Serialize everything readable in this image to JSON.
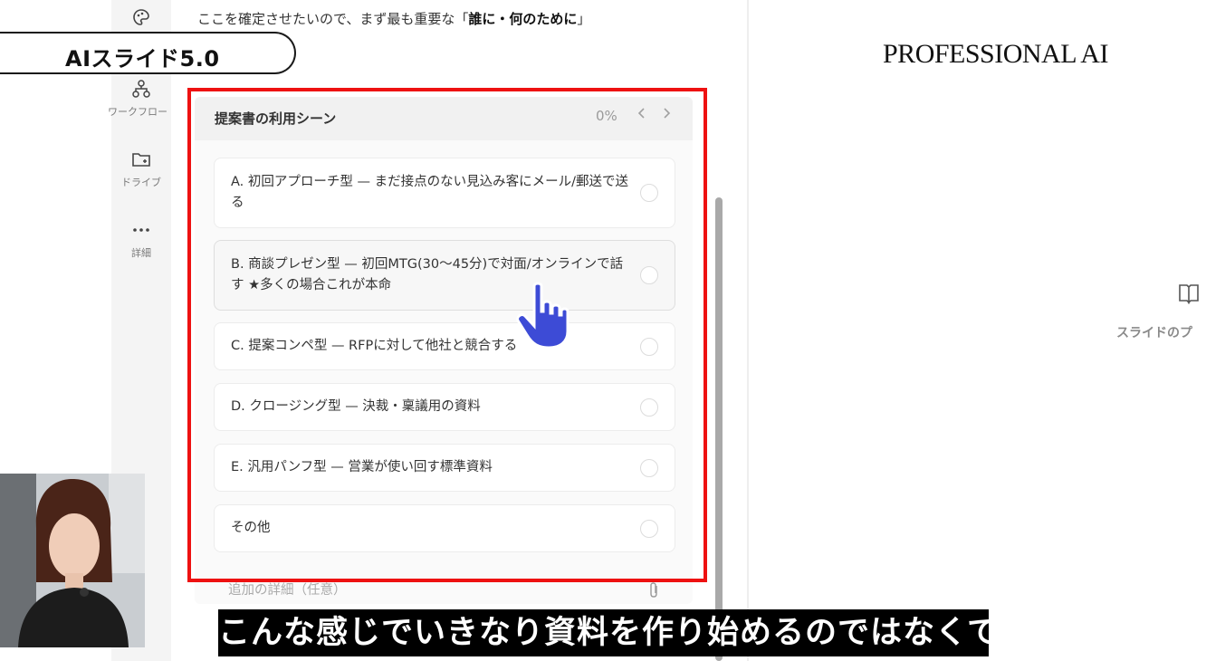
{
  "overlay": {
    "badge": "AIスライド5.0",
    "brand": "PROFESSIONAL AI",
    "caption": "こんな感じでいきなり資料を作り始めるのではなくて"
  },
  "sidebar": {
    "items": [
      {
        "label": "ワークフロー",
        "icon": "workflow-icon"
      },
      {
        "label": "ドライブ",
        "icon": "drive-folder-icon"
      },
      {
        "label": "詳細",
        "icon": "more-icon"
      }
    ]
  },
  "chat": {
    "intro_prefix": "ここを確定させたいので、まず最も重要な「",
    "intro_bold": "誰に・何のために",
    "intro_suffix": "」"
  },
  "question": {
    "title": "提案書の利用シーン",
    "progress": "0%",
    "options": [
      "A. 初回アプローチ型 — まだ接点のない見込み客にメール/郵送で送る",
      "B. 商談プレゼン型 — 初回MTG(30〜45分)で対面/オンラインで話す ★多くの場合これが本命",
      "C. 提案コンペ型 — RFPに対して他社と競合する",
      "D. クロージング型 — 決裁・稟議用の資料",
      "E. 汎用パンフ型 — 営業が使い回す標準資料",
      "その他"
    ],
    "details_placeholder": "追加の詳細（任意）"
  },
  "preview": {
    "label": "スライドのプ"
  },
  "colors": {
    "highlight_frame": "#ee1111",
    "cursor": "#3d4bd6"
  }
}
